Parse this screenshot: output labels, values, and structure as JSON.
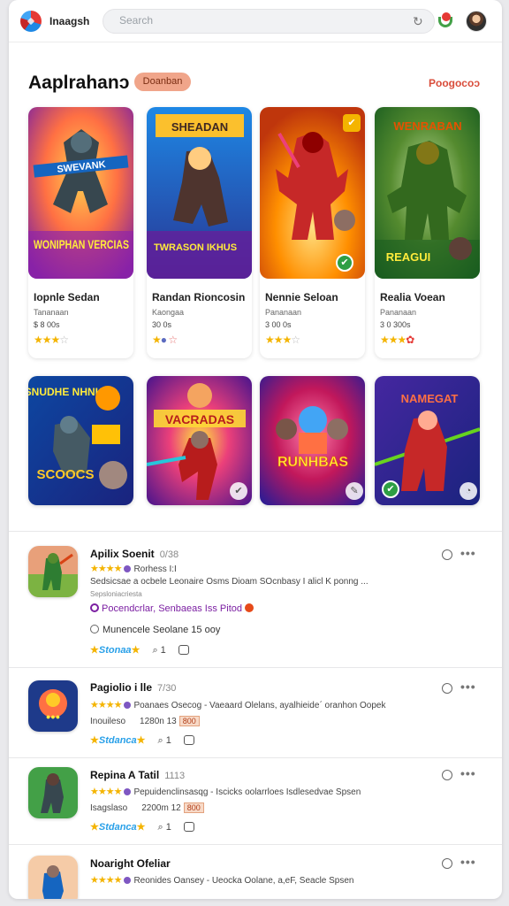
{
  "header": {
    "brand": "Inaagsh",
    "search_placeholder": "Search"
  },
  "section": {
    "title": "Aaplrahanɔ",
    "pill": "Doanban",
    "link": "Poogocoɔ"
  },
  "cards": [
    {
      "art_top": "SWEVANK",
      "art_bottom": "WONIPHAN VERCIAS",
      "title": "Iopnle Sedan",
      "sub": "Tananaan",
      "price": "$ 8 00s",
      "stars": 3
    },
    {
      "art_top": "SHEADAN",
      "art_bottom": "TWRASON IKHUS",
      "title": "Randan Rioncosin",
      "sub": "Kaongaa",
      "price": "30 0s",
      "stars": 2
    },
    {
      "art_top": "",
      "art_bottom": "",
      "title": "Nennie Seloan",
      "sub": "Pananaan",
      "price": "3 00 0s",
      "stars": 3
    },
    {
      "art_top": "WENRABAN",
      "art_bottom": "REAGUI",
      "title": "Realia Voean",
      "sub": "Pananaan",
      "price": "3 0 300s",
      "stars": 3
    }
  ],
  "tiles": [
    {
      "top": "SNUDHE NHNK",
      "bottom": "SCOOCS"
    },
    {
      "top": "VACRADAS",
      "bottom": ""
    },
    {
      "top": "",
      "bottom": "RUNHBAS"
    },
    {
      "top": "NAMEGAT",
      "bottom": ""
    }
  ],
  "list": [
    {
      "title": "Apilix Soenit",
      "num": "0/38",
      "line1": "Rorhess  I:I",
      "line2": "Sedsicsae  a ocbele  Leonaire Osms  Dioam  SOcnbasy  I alicl  K ponng ...",
      "line3": "Sepsloniacriesta",
      "tag": "Pocendcrlar,  Senbaeas Iss  Pitod",
      "meta": "Munencele  Seolane  15 ooy",
      "rate_label": "Stonaa",
      "comments": "1"
    },
    {
      "title": "Pagiolio i lle",
      "num": "7/30",
      "line1": "Poanaes Osecog -  Vaeaard  Olelans, ayalhieideˊ  oranhon Oopek",
      "sub2": "Inouileso",
      "sub2b": "1280n  13",
      "badge": "800",
      "rate_label": "Stdanca",
      "comments": "1"
    },
    {
      "title": "Repina A Tatil",
      "num": "1113",
      "line1": "Pepuidenclinsasqg -  Iscicks  oolarrloes  Isdlesedvae  Spsen",
      "sub2": "Isagslaso",
      "sub2b": "2200m  12",
      "badge": "800",
      "rate_label": "Stdanca",
      "comments": "1"
    },
    {
      "title": "Noaright Ofeliar",
      "num": "",
      "line1": "Reonides  Oansey -  Ueocka  Oolane,  a,eF,  Seacle  Spsen"
    }
  ]
}
